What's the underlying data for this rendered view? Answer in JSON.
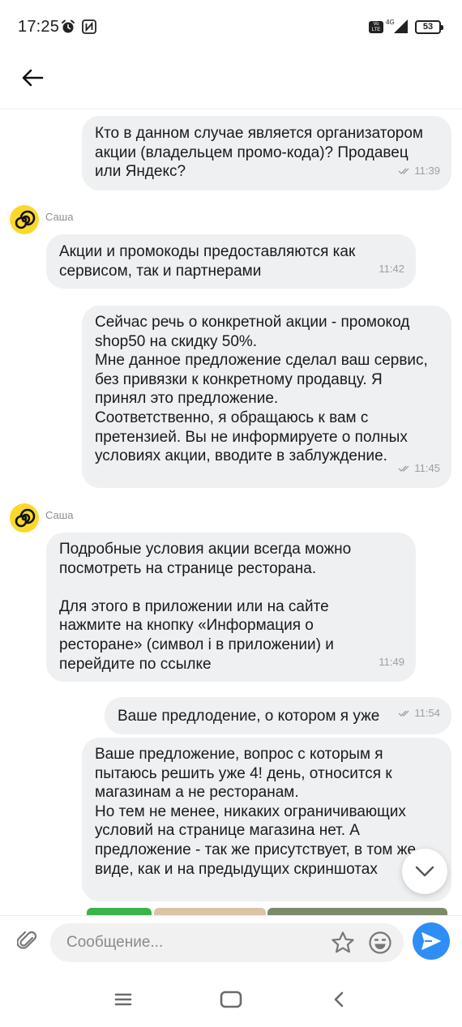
{
  "status_bar": {
    "time": "17:25",
    "network": "4G",
    "battery": "53",
    "icons": [
      "alarm-icon",
      "nfc-icon",
      "volte-icon",
      "signal-icon",
      "battery-icon"
    ]
  },
  "header": {
    "back_icon": "arrow-left-icon"
  },
  "agent": {
    "name": "Саша",
    "avatar_color": "#fcd82b"
  },
  "messages": [
    {
      "from": "user",
      "text": "Кто в данном случае является организатором\nакции (владельцем промо-кода)? Продавец\nили Яндекс?",
      "time": "11:39",
      "read": true
    },
    {
      "from": "agent",
      "sender": "Саша",
      "text": "Акции и промокоды предоставляются как\nсервисом, так и партнерами",
      "time": "11:42"
    },
    {
      "from": "user",
      "text": "Сейчас речь о конкретной акции - промокод\nshop50 на скидку 50%.\nМне данное предложение сделал ваш сервис,\nбез привязки к конкретному продавцу. Я\nпринял это предложение.\nСоответственно, я обращаюсь к вам с\nпретензией. Вы не информируете о полных\nусловиях акции, вводите в заблуждение.",
      "time": "11:45",
      "read": true
    },
    {
      "from": "agent",
      "sender": "Саша",
      "text": "Подробные условия акции всегда можно\nпосмотреть на странице ресторана.\n\nДля этого в приложении или на сайте\nнажмите на кнопку «Информация о\nресторане» (символ i в приложении) и\nперейдите по ссылке",
      "time": "11:49"
    },
    {
      "from": "user",
      "text": "Ваше предлодение, о котором я уже",
      "time": "11:54",
      "read": true
    },
    {
      "from": "user",
      "text": "Ваше предложение, вопрос с которым я\nпытаюсь решить уже 4! день, относится к\nмагазинам а не ресторанам.\nНо тем не менее, никаких ограничивающих\nусловий на странице магазина нет. А\nпредложение - так же присутствует, в том же\nвиде, как и на предыдущих скриншотах",
      "time": "",
      "read": true
    }
  ],
  "composer": {
    "placeholder": "Сообщение..."
  },
  "colors": {
    "bubble": "#eef0f2",
    "send": "#2e8ef5",
    "avatar": "#fcd82b"
  },
  "navigation": [
    "menu-icon",
    "home-icon",
    "back-icon"
  ]
}
